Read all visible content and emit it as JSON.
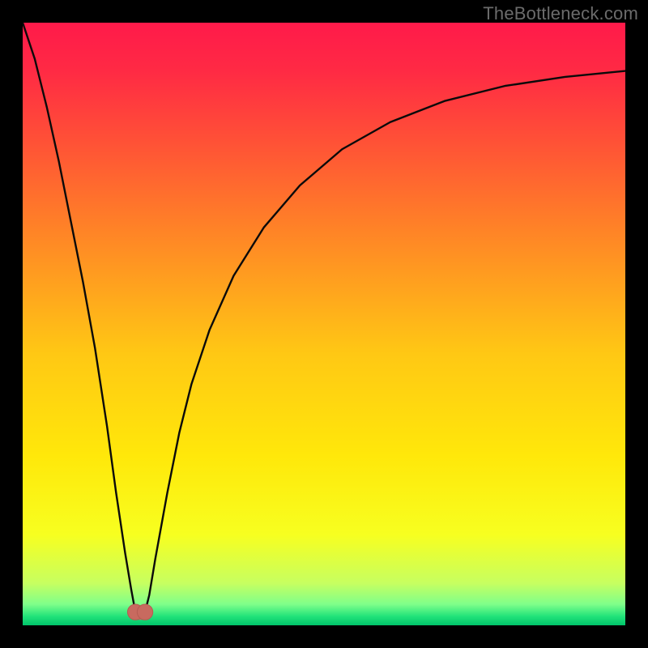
{
  "watermark": "TheBottleneck.com",
  "colors": {
    "frame": "#000000",
    "watermark": "#6b6b6b",
    "gradient_stops": [
      {
        "offset": 0.0,
        "color": "#ff1a4a"
      },
      {
        "offset": 0.08,
        "color": "#ff2a44"
      },
      {
        "offset": 0.2,
        "color": "#ff5236"
      },
      {
        "offset": 0.35,
        "color": "#ff8526"
      },
      {
        "offset": 0.55,
        "color": "#ffc814"
      },
      {
        "offset": 0.72,
        "color": "#ffe80a"
      },
      {
        "offset": 0.85,
        "color": "#f7ff20"
      },
      {
        "offset": 0.93,
        "color": "#c7ff60"
      },
      {
        "offset": 0.965,
        "color": "#7fff8a"
      },
      {
        "offset": 0.985,
        "color": "#22e37a"
      },
      {
        "offset": 1.0,
        "color": "#00c46a"
      }
    ],
    "curve_stroke": "#0a0a0a",
    "marker_fill": "#c86a5f",
    "marker_stroke": "#b55b52"
  },
  "chart_data": {
    "type": "line",
    "title": "",
    "xlabel": "",
    "ylabel": "",
    "xlim": [
      0,
      100
    ],
    "ylim": [
      0,
      100
    ],
    "grid": false,
    "legend": false,
    "annotations": [
      "TheBottleneck.com"
    ],
    "series": [
      {
        "name": "bottleneck-curve",
        "x": [
          0,
          2,
          4,
          6,
          8,
          10,
          12,
          14,
          15.5,
          17,
          18,
          18.7,
          19.5,
          20.3,
          21,
          22,
          24,
          26,
          28,
          31,
          35,
          40,
          46,
          53,
          61,
          70,
          80,
          90,
          100
        ],
        "y": [
          100,
          94,
          86,
          77,
          67,
          57,
          46,
          33,
          22,
          12,
          6,
          2.2,
          1.8,
          2.2,
          5,
          11,
          22,
          32,
          40,
          49,
          58,
          66,
          73,
          79,
          83.5,
          87,
          89.5,
          91,
          92
        ],
        "note": "y is bottleneck percentage; 0 is optimal (green band at bottom), 100 is worst (red top). Minimum ≈ x=19.5."
      }
    ],
    "markers": [
      {
        "x": 18.7,
        "y": 2.2,
        "r": 1.3
      },
      {
        "x": 20.3,
        "y": 2.2,
        "r": 1.3
      }
    ],
    "marker_bridge": {
      "x0": 18.7,
      "x1": 20.3,
      "y": 1.6,
      "note": "tiny U-shaped pink connector between the two minimum markers"
    }
  }
}
